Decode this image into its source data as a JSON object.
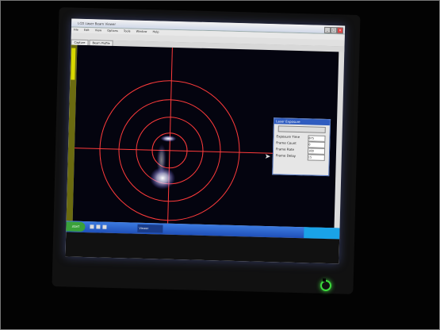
{
  "window": {
    "title": "LCD Laser Beam Viewer"
  },
  "menu": [
    "File",
    "Edit",
    "View",
    "Options",
    "Tools",
    "Window",
    "Help"
  ],
  "tabs": [
    "Capture",
    "Beam Profile"
  ],
  "laser_panel": {
    "title": "Laser Exposure",
    "rows": [
      {
        "label": "Exposure Time",
        "value": "875"
      },
      {
        "label": "Frame Count",
        "value": "0"
      },
      {
        "label": "Frame Rate",
        "value": "100"
      },
      {
        "label": "Frame Delay",
        "value": "15"
      }
    ]
  },
  "taskbar": {
    "start_label": "start",
    "app_label": "Viewer"
  },
  "colors": {
    "reticle": "#ff3b3b",
    "beam_glow": "#ecebff",
    "viewport_bg": "#04040f",
    "taskbar": "#2f62cc",
    "power_led": "#3ddc3d"
  }
}
